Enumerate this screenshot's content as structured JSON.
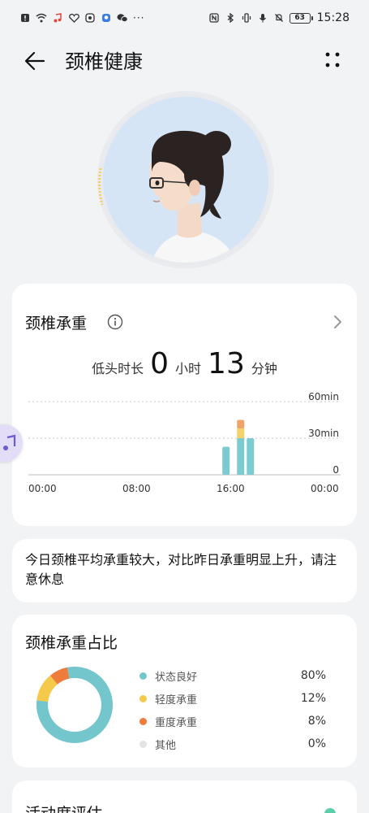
{
  "status_bar": {
    "time": "15:28",
    "battery": "63",
    "left_icons": [
      "alert-icon",
      "wifi-icon",
      "music-note-icon",
      "heart-icon",
      "app-icon",
      "bulb-icon",
      "wechat-icon"
    ],
    "overflow": "···"
  },
  "header": {
    "title": "颈椎健康"
  },
  "load_card": {
    "title": "颈椎承重",
    "duration_label": "低头时长",
    "hours": "0",
    "hours_unit": "小时",
    "minutes": "13",
    "minutes_unit": "分钟"
  },
  "chart_data": {
    "type": "bar",
    "x_ticks": [
      "00:00",
      "08:00",
      "16:00",
      "00:00"
    ],
    "y_ticks": [
      "60min",
      "30min",
      "0"
    ],
    "ylim": [
      0,
      60
    ],
    "bars": [
      {
        "hour": 16.2,
        "segments": [
          {
            "level": "light",
            "value": 0
          },
          {
            "level": "good",
            "value": 23
          }
        ]
      },
      {
        "hour": 17.4,
        "segments": [
          {
            "level": "good",
            "value": 30
          },
          {
            "level": "mild",
            "value": 8
          },
          {
            "level": "heavy",
            "value": 7
          }
        ]
      },
      {
        "hour": 18.2,
        "segments": [
          {
            "level": "good",
            "value": 30
          }
        ]
      }
    ],
    "colors": {
      "good": "#7ccbd0",
      "mild": "#f5d26b",
      "heavy": "#f0a36b"
    }
  },
  "tip_card": {
    "text": "今日颈椎平均承重较大，对比昨日承重明显上升，请注意休息"
  },
  "ratio_card": {
    "title": "颈椎承重占比",
    "items": [
      {
        "name": "状态良好",
        "pct": "80%",
        "value": 80,
        "color": "#74c6cd"
      },
      {
        "name": "轻度承重",
        "pct": "12%",
        "value": 12,
        "color": "#f5c94a"
      },
      {
        "name": "重度承重",
        "pct": "8%",
        "value": 8,
        "color": "#ee7d3c"
      },
      {
        "name": "其他",
        "pct": "0%",
        "value": 0,
        "color": "#e3e3e3"
      }
    ]
  },
  "activity_card": {
    "title": "活动度评估",
    "accent": "#5ccfa8"
  }
}
